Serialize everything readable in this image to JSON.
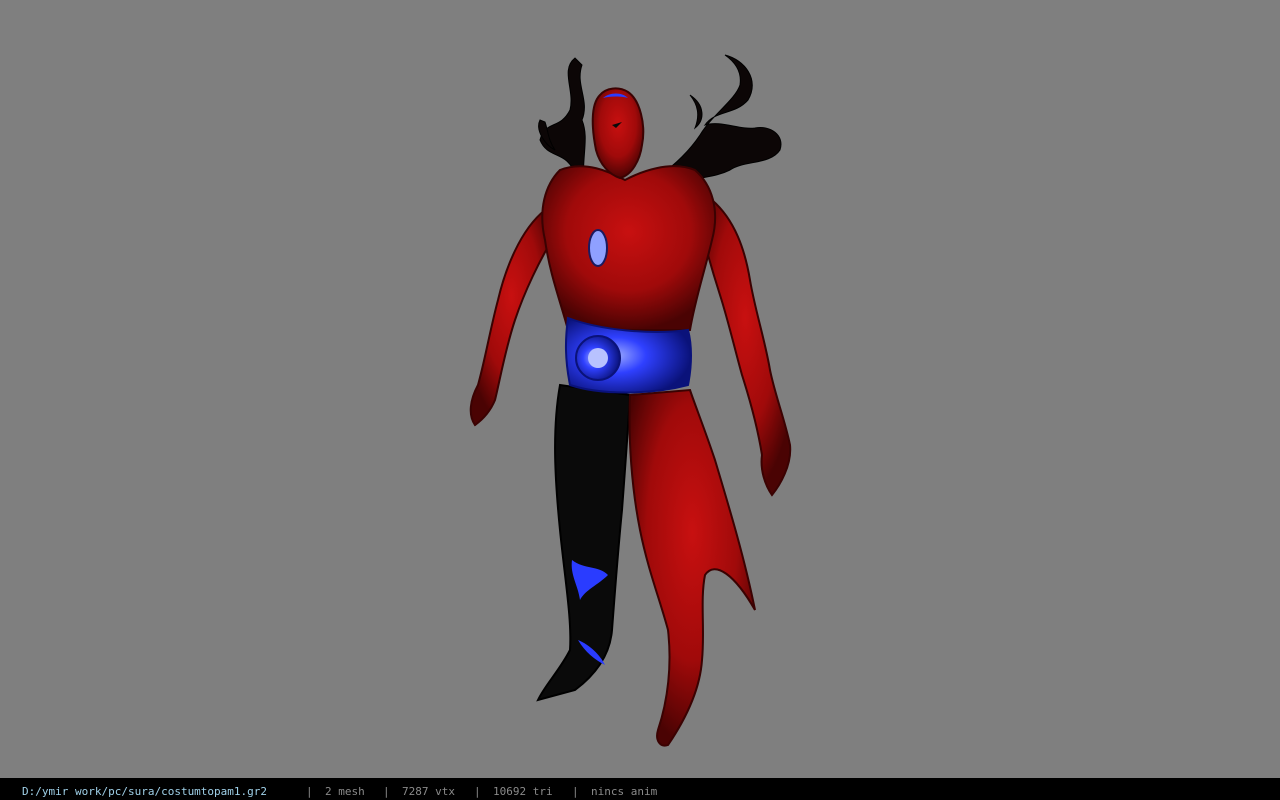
{
  "viewport": {
    "background": "#7f7f7f",
    "model_colors": {
      "skin": "#b00d0d",
      "shadow": "#3a0202",
      "dark": "#0a0a0a",
      "accent_blue": "#2a3cff",
      "highlight_blue": "#8fa0ff"
    }
  },
  "statusbar": {
    "file_path": "D:/ymir work/pc/sura/costumtopam1.gr2",
    "separator": "|",
    "mesh_count": "2 mesh",
    "vertex_count": "7287 vtx",
    "triangle_count": "10692 tri",
    "anim_status": "nincs anim"
  }
}
